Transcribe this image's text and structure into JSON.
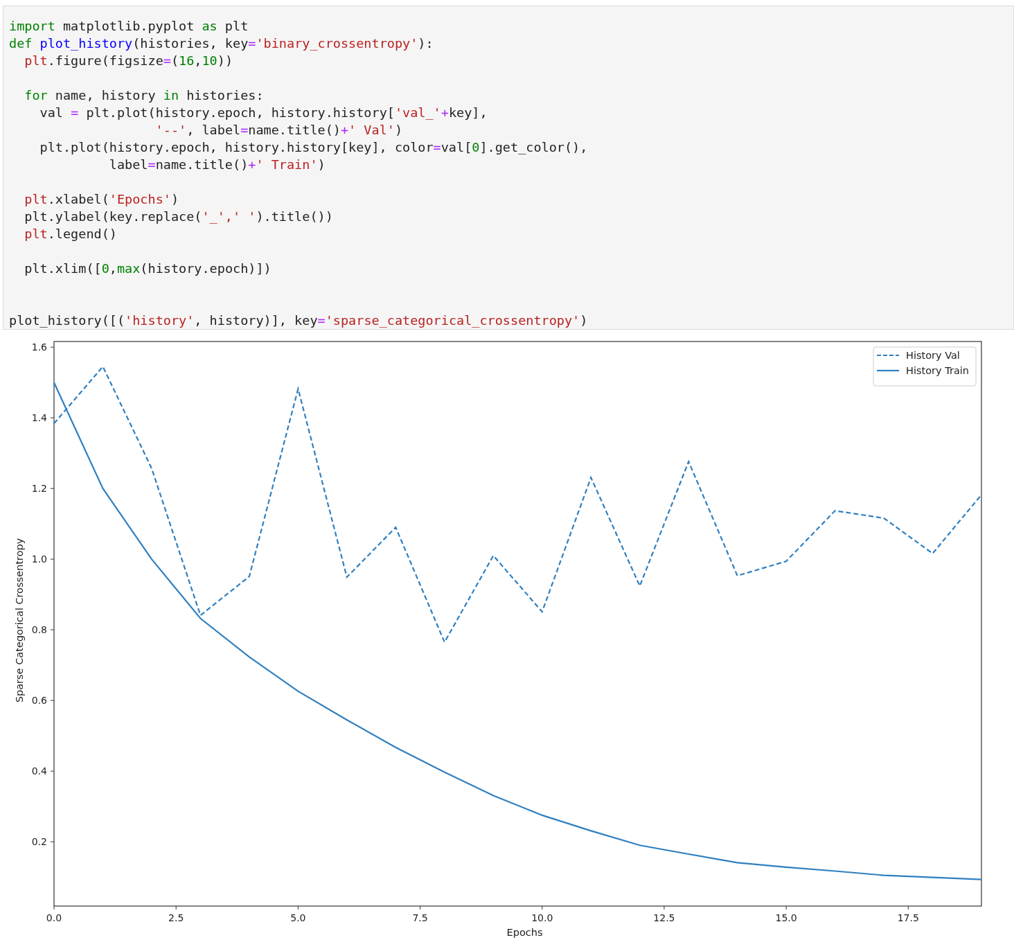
{
  "code_cell": {
    "lines": [
      {
        "kind": "code",
        "tokens": [
          {
            "color": "#008000",
            "t": "import"
          },
          {
            "color": "#222222",
            "t": " matplotlib.pyplot "
          },
          {
            "color": "#008000",
            "t": "as"
          },
          {
            "color": "#222222",
            "t": " plt"
          }
        ]
      },
      {
        "kind": "code",
        "tokens": [
          {
            "color": "#008000",
            "t": "def"
          },
          {
            "color": "#0000ff",
            "t": " plot_history"
          },
          {
            "color": "#222222",
            "t": "(histories, key"
          },
          {
            "color": "#aa22ff",
            "t": "="
          },
          {
            "color": "#ba2121",
            "t": "'binary_crossentropy'"
          },
          {
            "color": "#222222",
            "t": "):"
          }
        ]
      },
      {
        "kind": "code",
        "tokens": [
          {
            "color": "#ba2121",
            "t": "  plt"
          },
          {
            "color": "#222222",
            "t": ".figure(figsize"
          },
          {
            "color": "#aa22ff",
            "t": "="
          },
          {
            "color": "#222222",
            "t": "("
          },
          {
            "color": "#008000",
            "t": "16"
          },
          {
            "color": "#222222",
            "t": ","
          },
          {
            "color": "#008000",
            "t": "10"
          },
          {
            "color": "#222222",
            "t": "))"
          }
        ]
      },
      {
        "kind": "blank"
      },
      {
        "kind": "code",
        "tokens": [
          {
            "color": "#008000",
            "t": "  for"
          },
          {
            "color": "#222222",
            "t": " name, history "
          },
          {
            "color": "#008000",
            "t": "in"
          },
          {
            "color": "#222222",
            "t": " histories:"
          }
        ]
      },
      {
        "kind": "code",
        "tokens": [
          {
            "color": "#222222",
            "t": "    val "
          },
          {
            "color": "#aa22ff",
            "t": "="
          },
          {
            "color": "#222222",
            "t": " plt.plot(history.epoch, history.history["
          },
          {
            "color": "#ba2121",
            "t": "'val_'"
          },
          {
            "color": "#aa22ff",
            "t": "+"
          },
          {
            "color": "#222222",
            "t": "key],"
          }
        ]
      },
      {
        "kind": "code",
        "tokens": [
          {
            "color": "#ba2121",
            "t": "                   '--'"
          },
          {
            "color": "#222222",
            "t": ", label"
          },
          {
            "color": "#aa22ff",
            "t": "="
          },
          {
            "color": "#222222",
            "t": "name.title()"
          },
          {
            "color": "#aa22ff",
            "t": "+"
          },
          {
            "color": "#ba2121",
            "t": "' Val'"
          },
          {
            "color": "#222222",
            "t": ")"
          }
        ]
      },
      {
        "kind": "code",
        "tokens": [
          {
            "color": "#222222",
            "t": "    plt.plot(history.epoch, history.history[key], color"
          },
          {
            "color": "#aa22ff",
            "t": "="
          },
          {
            "color": "#222222",
            "t": "val["
          },
          {
            "color": "#008000",
            "t": "0"
          },
          {
            "color": "#222222",
            "t": "].get_color(),"
          }
        ]
      },
      {
        "kind": "code",
        "tokens": [
          {
            "color": "#222222",
            "t": "             label"
          },
          {
            "color": "#aa22ff",
            "t": "="
          },
          {
            "color": "#222222",
            "t": "name.title()"
          },
          {
            "color": "#aa22ff",
            "t": "+"
          },
          {
            "color": "#ba2121",
            "t": "' Train'"
          },
          {
            "color": "#222222",
            "t": ")"
          }
        ]
      },
      {
        "kind": "blank"
      },
      {
        "kind": "code",
        "tokens": [
          {
            "color": "#ba2121",
            "t": "  plt"
          },
          {
            "color": "#222222",
            "t": ".xlabel("
          },
          {
            "color": "#ba2121",
            "t": "'Epochs'"
          },
          {
            "color": "#222222",
            "t": ")"
          }
        ]
      },
      {
        "kind": "code",
        "tokens": [
          {
            "color": "#222222",
            "t": "  plt.ylabel(key.replace("
          },
          {
            "color": "#ba2121",
            "t": "'_',' '"
          },
          {
            "color": "#222222",
            "t": ").title())"
          }
        ]
      },
      {
        "kind": "code",
        "tokens": [
          {
            "color": "#ba2121",
            "t": "  plt"
          },
          {
            "color": "#222222",
            "t": ".legend()"
          }
        ]
      },
      {
        "kind": "blank"
      },
      {
        "kind": "code",
        "tokens": [
          {
            "color": "#222222",
            "t": "  plt.xlim(["
          },
          {
            "color": "#008000",
            "t": "0"
          },
          {
            "color": "#222222",
            "t": ","
          },
          {
            "color": "#008000",
            "t": "max"
          },
          {
            "color": "#222222",
            "t": "(history.epoch)])"
          }
        ]
      },
      {
        "kind": "blank"
      },
      {
        "kind": "blank"
      },
      {
        "kind": "code",
        "tokens": [
          {
            "color": "#222222",
            "t": "plot_history([("
          },
          {
            "color": "#ba2121",
            "t": "'history'"
          },
          {
            "color": "#222222",
            "t": ", history)], key"
          },
          {
            "color": "#aa22ff",
            "t": "="
          },
          {
            "color": "#ba2121",
            "t": "'sparse_categorical_crossentropy'"
          },
          {
            "color": "#222222",
            "t": ")"
          }
        ]
      }
    ]
  },
  "output": {
    "chart_data": {
      "type": "line",
      "xlabel": "Epochs",
      "ylabel": "Sparse Categorical Crossentropy",
      "x": [
        0,
        1,
        2,
        3,
        4,
        5,
        6,
        7,
        8,
        9,
        10,
        11,
        12,
        13,
        14,
        15,
        16,
        17,
        18,
        19
      ],
      "series": [
        {
          "name": "History Val",
          "color": "#2f7fc0",
          "line_style": "dashed",
          "values": [
            1.384,
            1.545,
            1.257,
            0.841,
            0.951,
            1.482,
            0.949,
            1.09,
            0.765,
            1.01,
            0.851,
            1.231,
            0.924,
            1.276,
            0.953,
            0.994,
            1.137,
            1.116,
            1.016,
            1.182
          ]
        },
        {
          "name": "History Train",
          "color": "#2f7fc0",
          "line_style": "solid",
          "values": [
            1.5,
            1.2,
            1.0,
            0.832,
            0.723,
            0.626,
            0.545,
            0.467,
            0.397,
            0.331,
            0.275,
            0.231,
            0.19,
            0.165,
            0.141,
            0.128,
            0.117,
            0.105,
            0.099,
            0.093
          ]
        }
      ],
      "legend": "upper right",
      "xlim": [
        0,
        19
      ],
      "ylim": [
        0.018,
        1.616
      ],
      "xticks": [
        {
          "value": 0,
          "label": "0.0"
        },
        {
          "value": 2.5,
          "label": "2.5"
        },
        {
          "value": 5,
          "label": "5.0"
        },
        {
          "value": 7.5,
          "label": "7.5"
        },
        {
          "value": 10,
          "label": "10.0"
        },
        {
          "value": 12.5,
          "label": "12.5"
        },
        {
          "value": 15,
          "label": "15.0"
        },
        {
          "value": 17.5,
          "label": "17.5"
        }
      ],
      "yticks": [
        {
          "value": 0.2,
          "label": "0.2"
        },
        {
          "value": 0.4,
          "label": "0.4"
        },
        {
          "value": 0.6,
          "label": "0.6"
        },
        {
          "value": 0.8,
          "label": "0.8"
        },
        {
          "value": 1.0,
          "label": "1.0"
        },
        {
          "value": 1.2,
          "label": "1.2"
        },
        {
          "value": 1.4,
          "label": "1.4"
        },
        {
          "value": 1.6,
          "label": "1.6"
        }
      ]
    }
  }
}
